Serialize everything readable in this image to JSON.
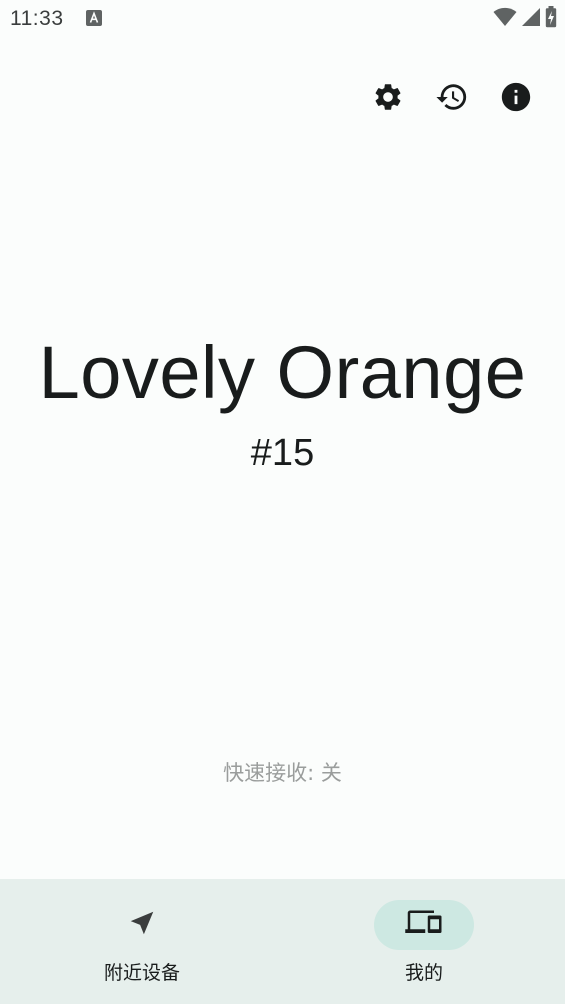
{
  "status_bar": {
    "time": "11:33",
    "notification_icon": "a-letter-icon",
    "icons": [
      "wifi-icon",
      "signal-icon",
      "battery-charging-icon"
    ]
  },
  "toolbar": {
    "icons": [
      "settings-gear-icon",
      "history-icon",
      "info-icon"
    ]
  },
  "device": {
    "name": "Lovely Orange",
    "number": "#15"
  },
  "quick_receive": {
    "text": "快速接收: 关"
  },
  "bottom_nav": {
    "items": [
      {
        "label": "附近设备",
        "icon": "navigation-arrow-icon",
        "selected": false
      },
      {
        "label": "我的",
        "icon": "devices-icon",
        "selected": true
      }
    ]
  },
  "colors": {
    "background": "#fbfdfc",
    "nav_background": "#e6efec",
    "nav_selected_pill": "#cde8e2",
    "text_primary": "#191c1c",
    "text_secondary": "#9a9d9c"
  }
}
